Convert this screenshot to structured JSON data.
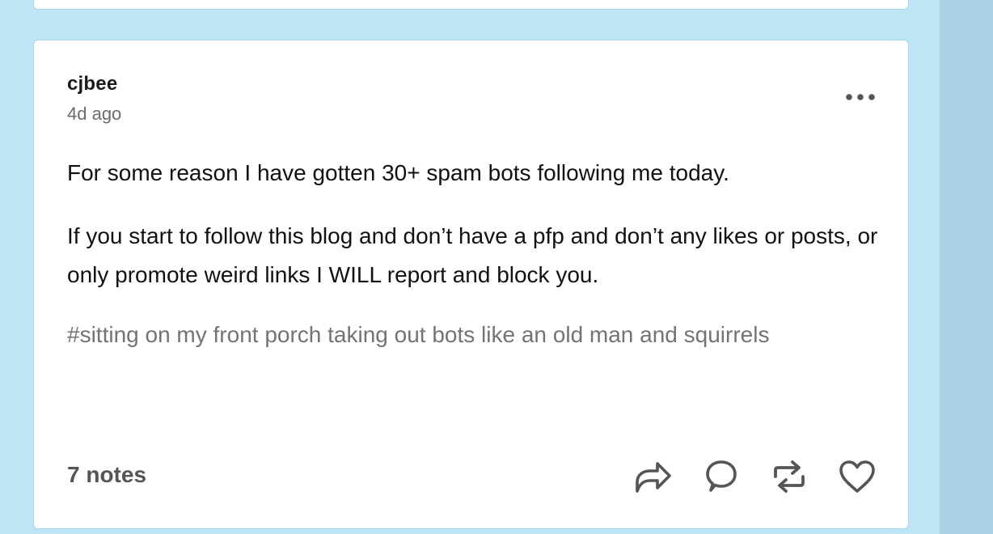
{
  "post": {
    "username": "cjbee",
    "timestamp": "4d ago",
    "paragraphs": [
      "For some reason I have gotten 30+ spam bots following me today.",
      "If you start to follow this blog and don’t have a pfp and don’t any likes or posts, or only promote weird links I WILL report and block you."
    ],
    "tags": "#sitting on my front porch taking out bots like an old man and squirrels",
    "notes": "7 notes"
  },
  "icons": {
    "more": "ellipsis-icon",
    "share": "share-arrow-icon",
    "reply": "speech-bubble-icon",
    "reblog": "reblog-icon",
    "like": "heart-icon"
  },
  "colors": {
    "background": "#bde5f6",
    "side_strip": "#a9d1e3",
    "card": "#ffffff",
    "text": "#111111",
    "muted": "#737373",
    "icon": "#555555"
  }
}
